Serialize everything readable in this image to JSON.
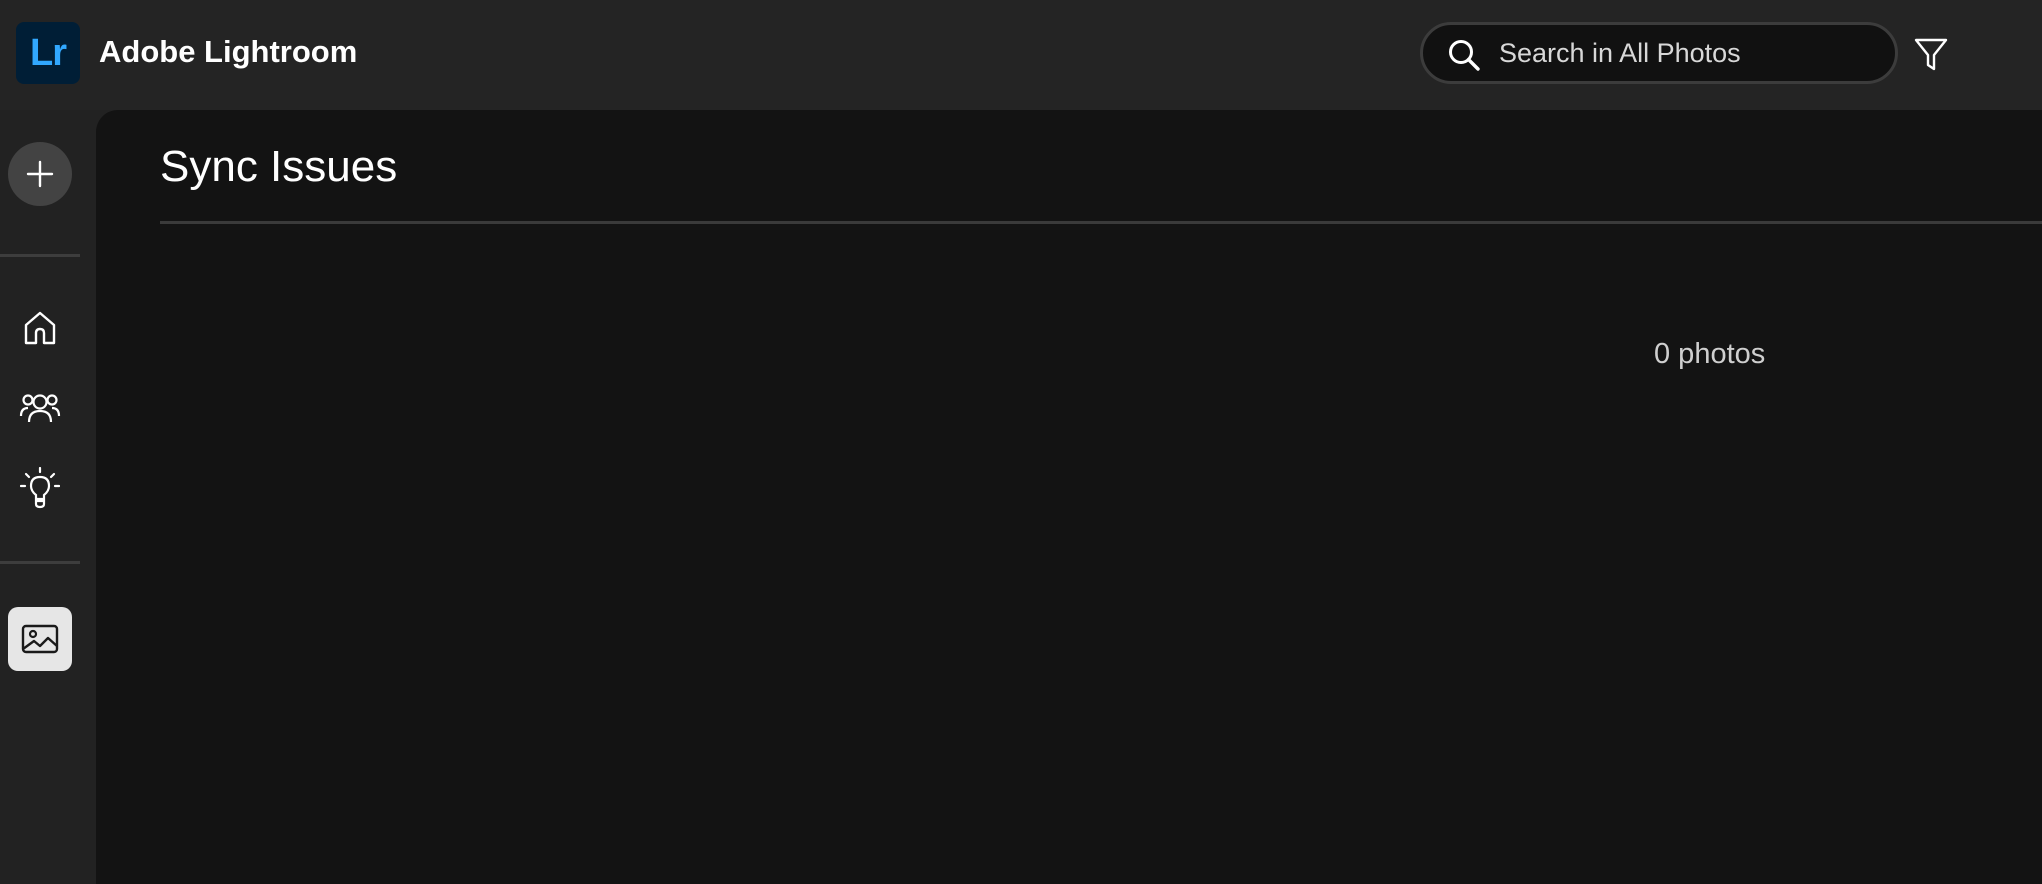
{
  "app": {
    "logo_text": "Lr",
    "title": "Adobe Lightroom",
    "brand_color": "#31a8ff"
  },
  "search": {
    "placeholder": "Search in All Photos",
    "value": "",
    "icon": "search-icon"
  },
  "toolbar": {
    "filter_icon": "filter-icon"
  },
  "rail": {
    "items": [
      {
        "icon": "plus-icon",
        "label": "Add photos"
      },
      {
        "icon": "home-icon",
        "label": "Home"
      },
      {
        "icon": "people-icon",
        "label": "Community"
      },
      {
        "icon": "lightbulb-icon",
        "label": "Learn"
      },
      {
        "icon": "photos-icon",
        "label": "My Photos",
        "active": true
      }
    ]
  },
  "main": {
    "title": "Sync Issues",
    "count_text": "0 photos"
  }
}
